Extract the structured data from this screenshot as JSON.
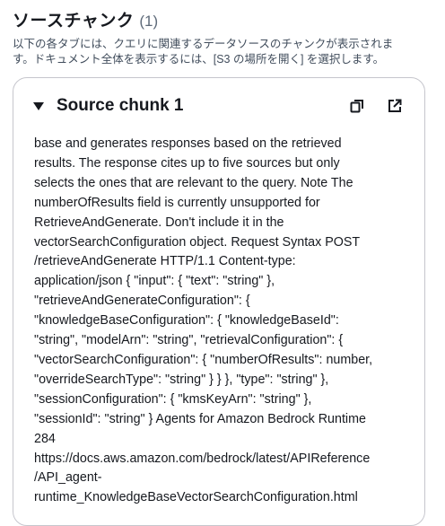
{
  "header": {
    "title": "ソースチャンク",
    "count": "(1)",
    "description": "以下の各タブには、クエリに関連するデータソースのチャンクが表示されま\nす。ドキュメント全体を表示するには、[S3 の場所を開く] を選択します。"
  },
  "chunk": {
    "title": "Source chunk 1",
    "lines": [
      "base and generates responses based on the retrieved",
      "results. The response cites up to five sources but only",
      "selects the ones that are relevant to the query. Note The",
      "numberOfResults field is currently unsupported for",
      "RetrieveAndGenerate. Don't include it in the",
      "vectorSearchConfiguration object. Request Syntax POST",
      "/retrieveAndGenerate HTTP/1.1 Content-type:",
      "application/json { \"input\": { \"text\": \"string\" },",
      "\"retrieveAndGenerateConfiguration\": {",
      "\"knowledgeBaseConfiguration\": { \"knowledgeBaseId\":",
      "\"string\", \"modelArn\": \"string\", \"retrievalConfiguration\": {",
      "\"vectorSearchConfiguration\": { \"numberOfResults\": number,",
      "\"overrideSearchType\": \"string\" } } }, \"type\": \"string\" },",
      "\"sessionConfiguration\": { \"kmsKeyArn\": \"string\" },",
      "\"sessionId\": \"string\" } Agents for Amazon Bedrock Runtime",
      "284",
      "https://docs.aws.amazon.com/bedrock/latest/APIReference",
      "/API_agent-",
      "runtime_KnowledgeBaseVectorSearchConfiguration.html"
    ]
  },
  "icons": {
    "copy": "copy-icon",
    "external": "external-link-icon"
  }
}
